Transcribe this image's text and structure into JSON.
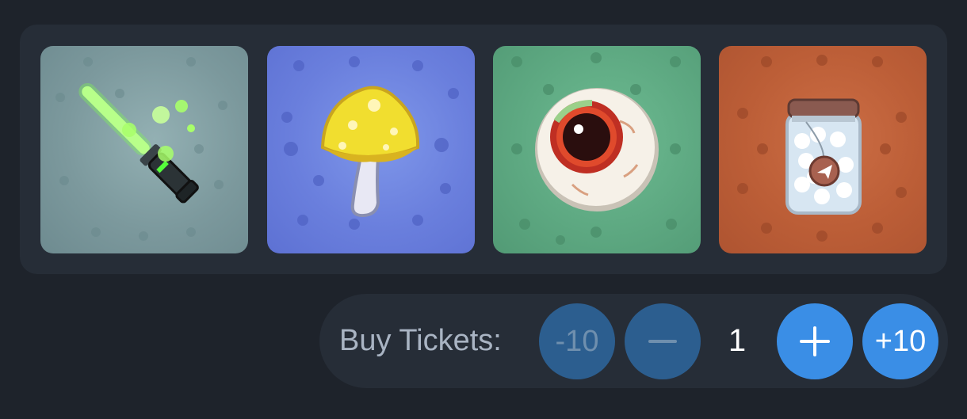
{
  "prizes": [
    {
      "name": "Light Sword",
      "icon": "light-sword-icon",
      "color": "#7c999d"
    },
    {
      "name": "Magic Mushroom",
      "icon": "mushroom-icon",
      "color": "#6a7fdd"
    },
    {
      "name": "Evil Eye",
      "icon": "eyeball-icon",
      "color": "#5ea982"
    },
    {
      "name": "Jar of Hearts",
      "icon": "jar-icon",
      "color": "#bc5e37"
    }
  ],
  "buy": {
    "label": "Buy Tickets:",
    "minus10": "-10",
    "minus1": "—",
    "quantity": "1",
    "plus1": "+",
    "plus10": "+10"
  },
  "colors": {
    "background": "#1e232b",
    "panel": "#262d37",
    "accent": "#3a8ee6",
    "accent_dim": "#2c5e8f"
  }
}
